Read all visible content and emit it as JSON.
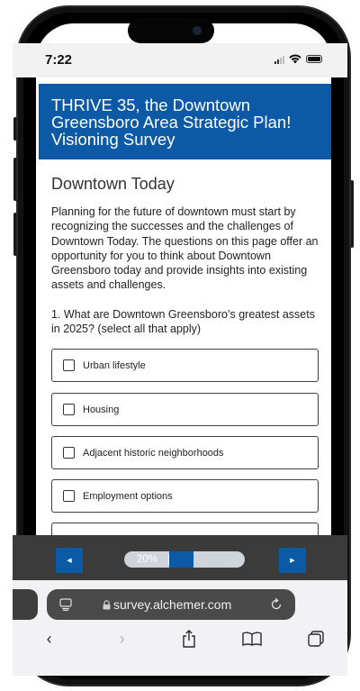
{
  "status_bar": {
    "time": "7:22"
  },
  "survey": {
    "title": "THRIVE 35, the Downtown Greensboro Area Strategic Plan! Visioning Survey",
    "page_title": "Downtown Today",
    "intro": "Planning for the future of downtown must start by recognizing the successes and the challenges of Downtown Today. The questions on this page offer an opportunity for you to think about Downtown Greensboro today and provide insights into existing assets and challenges.",
    "question": "1. What are Downtown Greensboro’s greatest assets in 2025? (select all that apply)",
    "options": [
      {
        "label": "Urban lifestyle",
        "checked": false
      },
      {
        "label": "Housing",
        "checked": false
      },
      {
        "label": "Adjacent historic neighborhoods",
        "checked": false
      },
      {
        "label": "Employment options",
        "checked": false
      }
    ]
  },
  "progress": {
    "percent_label": "20%",
    "value": 0.2
  },
  "browser": {
    "url": "survey.alchemer.com"
  },
  "colors": {
    "brand": "#0c5aa6",
    "navbar": "#3b3b3b"
  },
  "icons": {
    "back": "chevron-left-icon",
    "forward": "chevron-right-icon",
    "share": "share-icon",
    "bookmarks": "book-icon",
    "tabs": "tabs-icon"
  }
}
